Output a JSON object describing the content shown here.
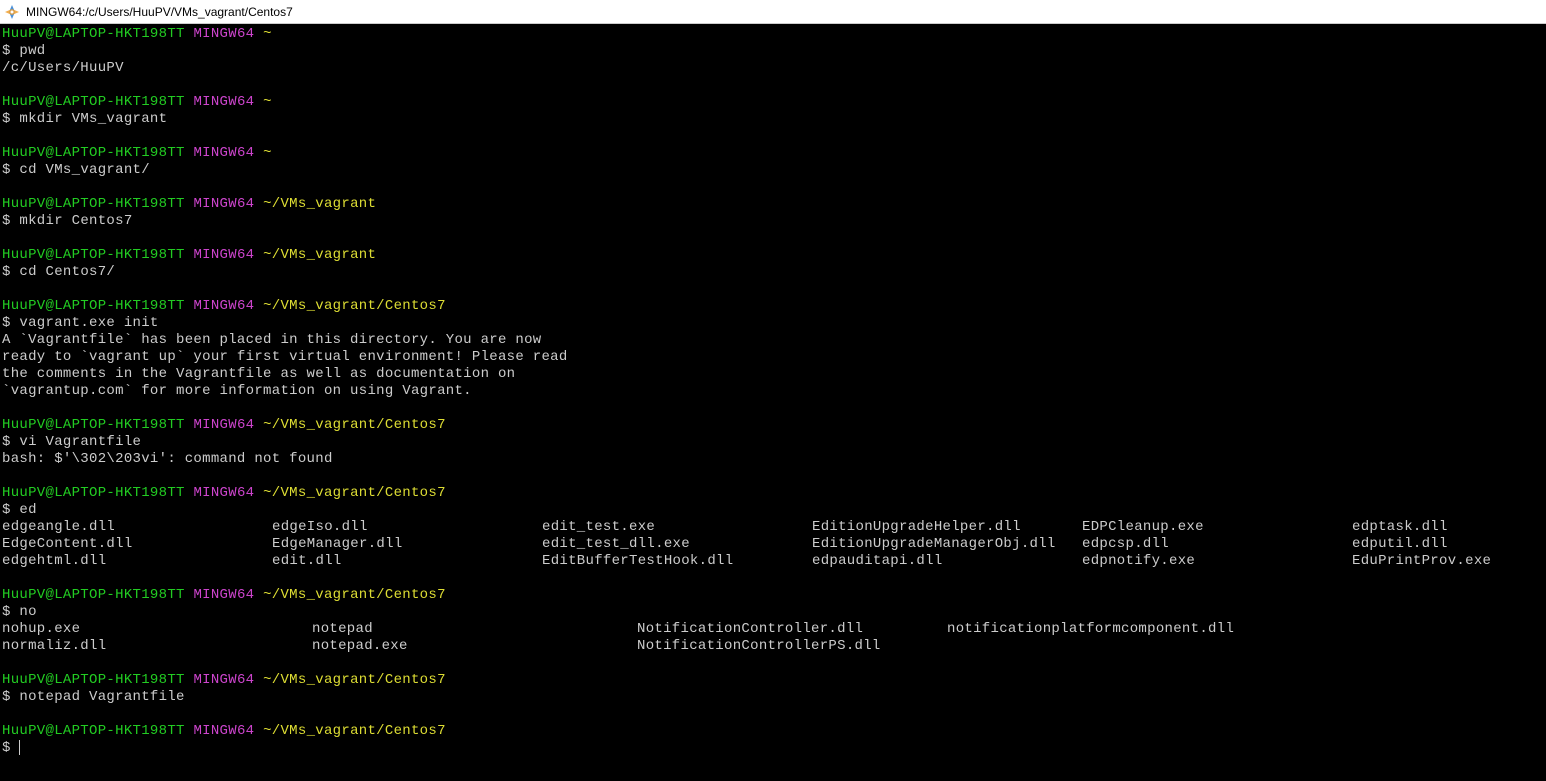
{
  "window": {
    "title": "MINGW64:/c/Users/HuuPV/VMs_vagrant/Centos7"
  },
  "prompt": {
    "user": "HuuPV@LAPTOP-HKT198TT",
    "host": "MINGW64",
    "paths": {
      "home": "~",
      "vms": "~/VMs_vagrant",
      "centos": "~/VMs_vagrant/Centos7"
    }
  },
  "blocks": [
    {
      "path": "home",
      "cmd": "pwd",
      "output": [
        "/c/Users/HuuPV"
      ]
    },
    {
      "path": "home",
      "cmd": "mkdir VMs_vagrant",
      "output": []
    },
    {
      "path": "home",
      "cmd": "cd VMs_vagrant/",
      "output": []
    },
    {
      "path": "vms",
      "cmd": "mkdir Centos7",
      "output": []
    },
    {
      "path": "vms",
      "cmd": "cd Centos7/",
      "output": []
    },
    {
      "path": "centos",
      "cmd": "vagrant.exe init",
      "output": [
        "A `Vagrantfile` has been placed in this directory. You are now",
        "ready to `vagrant up` your first virtual environment! Please read",
        "the comments in the Vagrantfile as well as documentation on",
        "`vagrantup.com` for more information on using Vagrant."
      ]
    },
    {
      "path": "centos",
      "cmd": "vi Vagrantfile",
      "output": [
        "bash: $'\\302\\203vi': command not found"
      ]
    },
    {
      "path": "centos",
      "cmd": "ed",
      "tab_rows": [
        [
          "edgeangle.dll",
          "edgeIso.dll",
          "edit_test.exe",
          "EditionUpgradeHelper.dll",
          "EDPCleanup.exe",
          "edptask.dll"
        ],
        [
          "EdgeContent.dll",
          "EdgeManager.dll",
          "edit_test_dll.exe",
          "EditionUpgradeManagerObj.dll",
          "edpcsp.dll",
          "edputil.dll"
        ],
        [
          "edgehtml.dll",
          "edit.dll",
          "EditBufferTestHook.dll",
          "edpauditapi.dll",
          "edpnotify.exe",
          "EduPrintProv.exe"
        ]
      ]
    },
    {
      "path": "centos",
      "cmd": "no",
      "tab_rows_b": [
        [
          "nohup.exe",
          "notepad",
          "NotificationController.dll",
          "notificationplatformcomponent.dll"
        ],
        [
          "normaliz.dll",
          "notepad.exe",
          "NotificationControllerPS.dll",
          ""
        ]
      ]
    },
    {
      "path": "centos",
      "cmd": "notepad Vagrantfile",
      "output": []
    },
    {
      "path": "centos",
      "cmd": "",
      "cursor": true
    }
  ]
}
